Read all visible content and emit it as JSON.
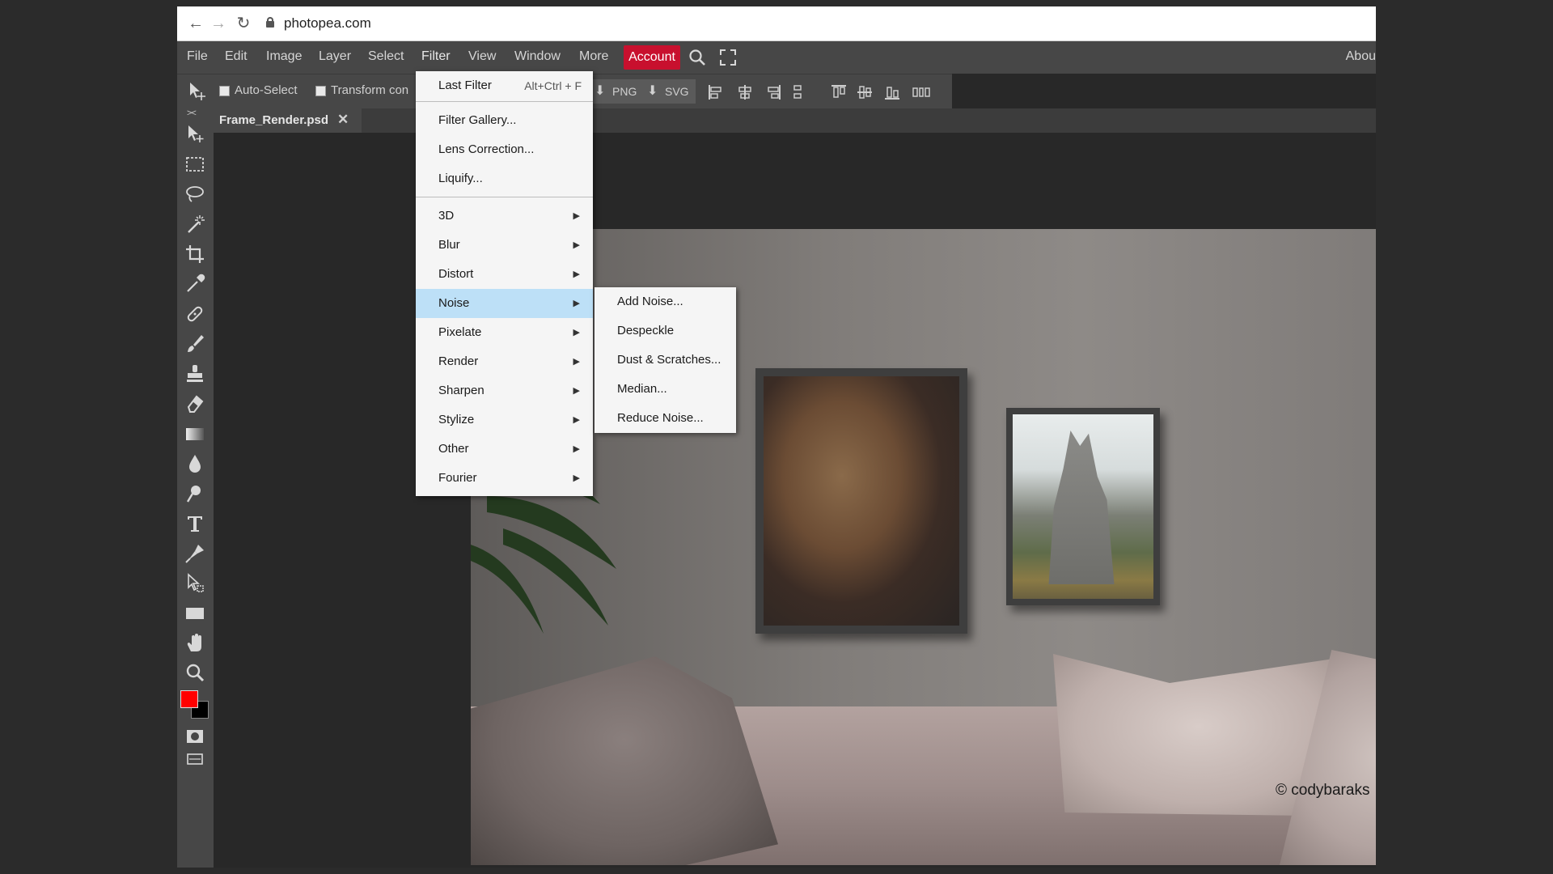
{
  "browser": {
    "url": "photopea.com"
  },
  "menubar": {
    "items": [
      "File",
      "Edit",
      "Image",
      "Layer",
      "Select",
      "Filter",
      "View",
      "Window",
      "More"
    ],
    "account": "Account",
    "about": "Abou"
  },
  "options": {
    "auto_select": "Auto-Select",
    "transform": "Transform con",
    "png": "PNG",
    "svg": "SVG"
  },
  "tab": {
    "title": "Frame_Render.psd",
    "close": "✕"
  },
  "toolbar": {
    "collapse": "><",
    "colors": {
      "foreground": "#ff0000",
      "background": "#000000"
    }
  },
  "filter_menu": {
    "last_filter": {
      "label": "Last Filter",
      "shortcut": "Alt+Ctrl + F"
    },
    "group1": [
      "Filter Gallery...",
      "Lens Correction...",
      "Liquify..."
    ],
    "submenus": [
      "3D",
      "Blur",
      "Distort",
      "Noise",
      "Pixelate",
      "Render",
      "Sharpen",
      "Stylize",
      "Other",
      "Fourier"
    ],
    "active": "Noise",
    "arrow": "▶"
  },
  "noise_submenu": [
    "Add Noise...",
    "Despeckle",
    "Dust & Scratches...",
    "Median...",
    "Reduce Noise..."
  ],
  "canvas": {
    "watermark": "© codybaraks"
  },
  "accent": {
    "account_red": "#c8102e",
    "menu_highlight": "#bde0f7"
  }
}
